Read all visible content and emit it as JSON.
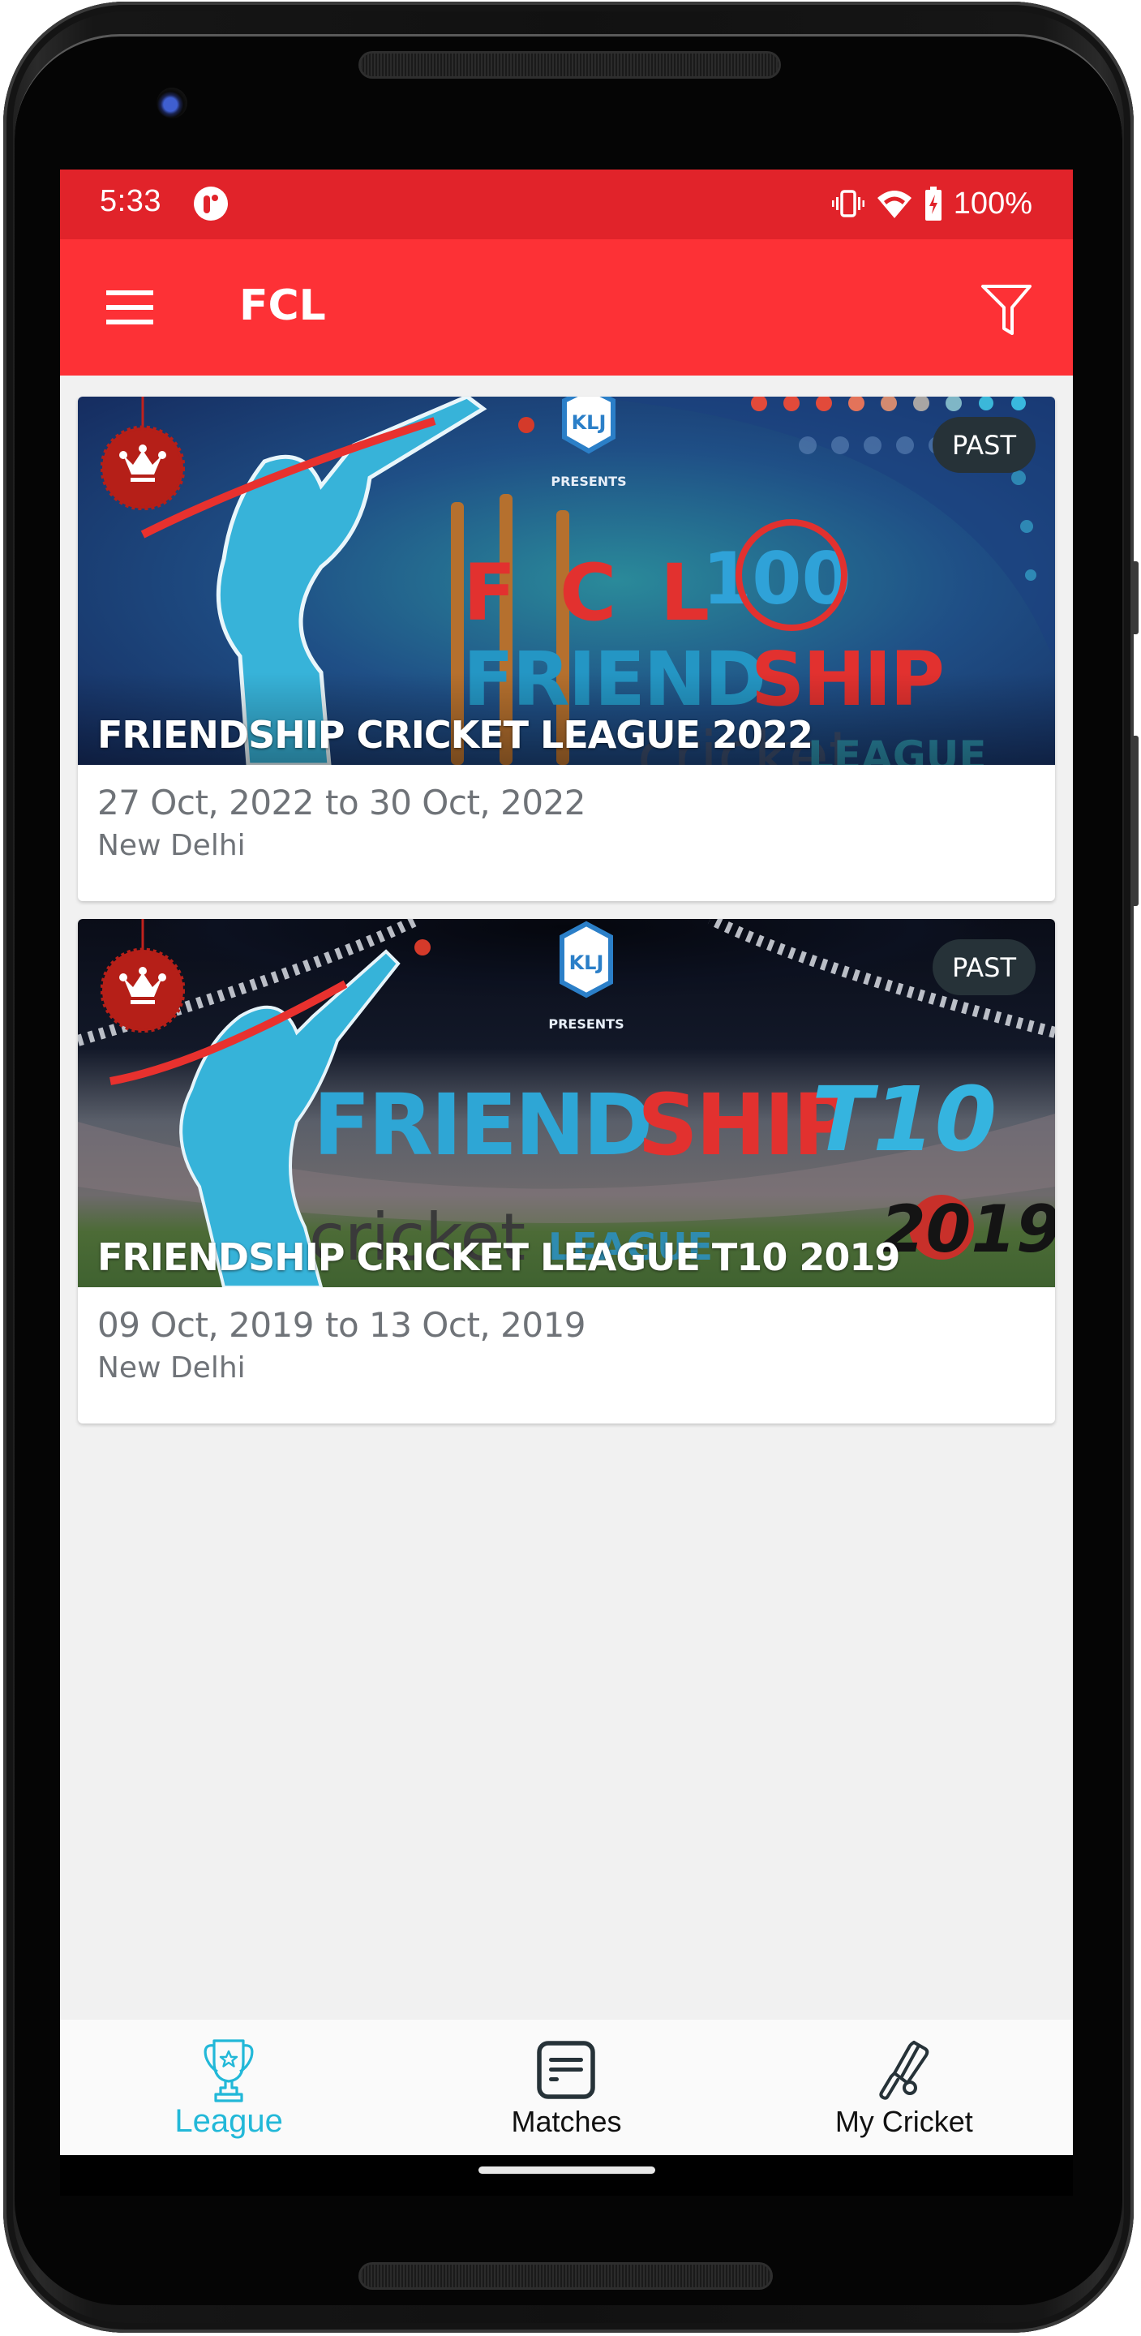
{
  "status_bar": {
    "time": "5:33",
    "notification_icon": "app-notification-icon",
    "icons": [
      "vibrate-icon",
      "wifi-icon",
      "battery-charging-icon"
    ],
    "battery": "100%"
  },
  "app_bar": {
    "menu_icon": "hamburger-menu-icon",
    "title": "FCL",
    "filter_icon": "filter-icon"
  },
  "colors": {
    "status_bar": "#e1232a",
    "app_bar": "#fd3136",
    "badge": "#263238",
    "active_tab": "#22b8d8",
    "muted_text": "#6f7378",
    "background": "#f1f1f1"
  },
  "leagues": [
    {
      "title": "FRIENDSHIP CRICKET LEAGUE 2022",
      "status": "PAST",
      "start_date": "27 Oct, 2022",
      "end_date": "to 30 Oct, 2022",
      "location": "New Delhi",
      "badge_icon": "crown-icon",
      "banner": {
        "sponsor": "KLJ",
        "presents": "PRESENTS",
        "line1": "F C L",
        "edition": "100",
        "line2a": "FRIEND",
        "line2b": "SHIP",
        "line3": "cricket",
        "line4": "LEAGUE"
      }
    },
    {
      "title": "FRIENDSHIP CRICKET LEAGUE T10 2019",
      "status": "PAST",
      "start_date": "09 Oct, 2019",
      "end_date": "to 13 Oct, 2019",
      "location": "New Delhi",
      "badge_icon": "crown-icon",
      "banner": {
        "sponsor": "KLJ",
        "presents": "PRESENTS",
        "line2a": "FRIEND",
        "line2b": "SHIP",
        "edition": "T10",
        "line3": "cricket",
        "line4": "LEAGUE",
        "year": "2019"
      }
    }
  ],
  "bottom_nav": {
    "items": [
      {
        "label": "League",
        "icon": "trophy-icon",
        "active": true
      },
      {
        "label": "Matches",
        "icon": "scorecard-icon",
        "active": false
      },
      {
        "label": "My Cricket",
        "icon": "cricket-bat-icon",
        "active": false
      }
    ]
  }
}
